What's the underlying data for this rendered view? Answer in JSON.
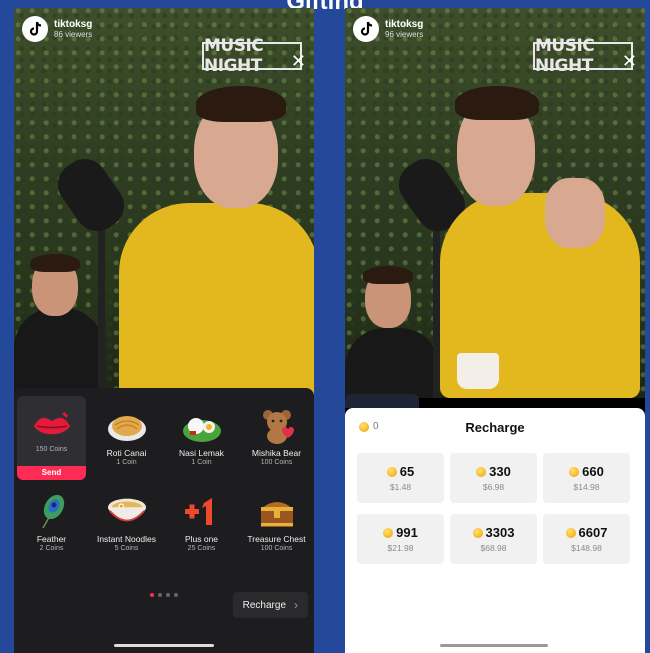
{
  "top_title": "Gifting",
  "left_screen": {
    "creator": {
      "name": "tiktoksg",
      "viewers": "86 viewers"
    },
    "brand": "MUSIC NIGHT",
    "close_icon": "close-icon",
    "gifts": [
      {
        "name": "",
        "cost": "150 Coins",
        "icon": "lips-icon",
        "selected": true,
        "action": "Send"
      },
      {
        "name": "Roti Canai",
        "cost": "1 Coin",
        "icon": "roti-canai-icon"
      },
      {
        "name": "Nasi Lemak",
        "cost": "1 Coin",
        "icon": "nasi-lemak-icon"
      },
      {
        "name": "Mishika Bear",
        "cost": "100 Coins",
        "icon": "bear-icon"
      },
      {
        "name": "Feather",
        "cost": "2 Coins",
        "icon": "feather-icon"
      },
      {
        "name": "Instant Noodles",
        "cost": "5 Coins",
        "icon": "noodles-icon"
      },
      {
        "name": "Plus one",
        "cost": "25 Coins",
        "icon": "plus-one-icon"
      },
      {
        "name": "Treasure Chest",
        "cost": "100 Coins",
        "icon": "treasure-chest-icon"
      }
    ],
    "page_dots": {
      "count": 4,
      "active": 0
    },
    "recharge_button": "Recharge"
  },
  "right_screen": {
    "creator": {
      "name": "tiktoksg",
      "viewers": "96 viewers"
    },
    "brand": "MUSIC NIGHT",
    "balance": "0",
    "title": "Recharge",
    "packages": [
      {
        "coins": "65",
        "price": "$1.48"
      },
      {
        "coins": "330",
        "price": "$6.98"
      },
      {
        "coins": "660",
        "price": "$14.98"
      },
      {
        "coins": "991",
        "price": "$21.98"
      },
      {
        "coins": "3303",
        "price": "$68.98"
      },
      {
        "coins": "6607",
        "price": "$148.98"
      }
    ]
  },
  "colors": {
    "accent": "#fe2c55",
    "background": "#24489a",
    "coin": "#f6b21c"
  }
}
